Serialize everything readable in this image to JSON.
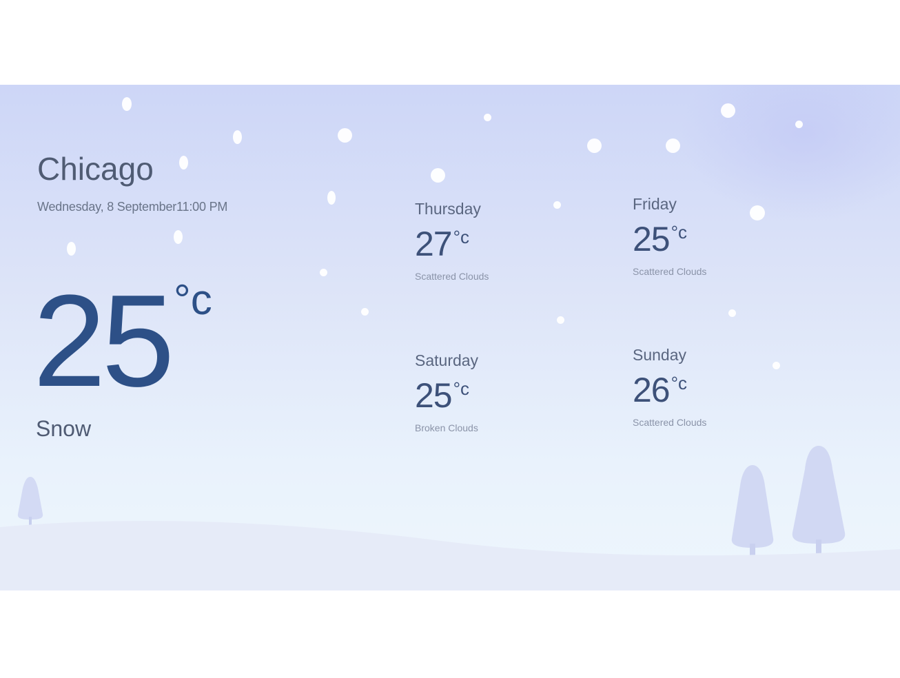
{
  "current": {
    "city": "Chicago",
    "datetime": "Wednesday, 8 September11:00 PM",
    "temperature": "25",
    "unit": "°c",
    "condition": "Snow"
  },
  "forecast": [
    {
      "day": "Thursday",
      "temp": "27",
      "unit": "°c",
      "condition": "Scattered Clouds"
    },
    {
      "day": "Friday",
      "temp": "25",
      "unit": "°c",
      "condition": "Scattered Clouds"
    },
    {
      "day": "Saturday",
      "temp": "25",
      "unit": "°c",
      "condition": "Broken Clouds"
    },
    {
      "day": "Sunday",
      "temp": "26",
      "unit": "°c",
      "condition": "Scattered Clouds"
    }
  ],
  "colors": {
    "accent": "#2d5087",
    "text": "#4f5b73",
    "sky_top": "#cdd6f7",
    "sky_bottom": "#eef6fd"
  }
}
